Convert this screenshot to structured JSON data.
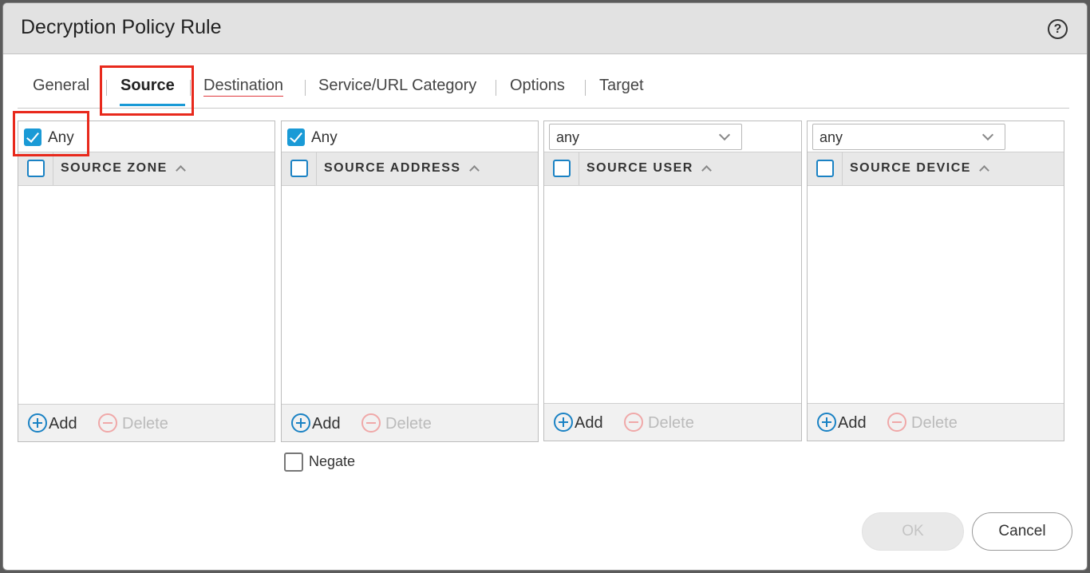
{
  "dialog": {
    "title": "Decryption Policy Rule",
    "help_icon": "question-circle-icon"
  },
  "tabs": [
    {
      "label": "General"
    },
    {
      "label": "Source",
      "active": true
    },
    {
      "label": "Destination"
    },
    {
      "label": "Service/URL Category"
    },
    {
      "label": "Options"
    },
    {
      "label": "Target"
    }
  ],
  "panels": {
    "source_zone": {
      "any_label": "Any",
      "any_checked": true,
      "header": "SOURCE ZONE"
    },
    "source_address": {
      "any_label": "Any",
      "any_checked": true,
      "header": "SOURCE ADDRESS"
    },
    "source_user": {
      "select_value": "any",
      "header": "SOURCE USER"
    },
    "source_device": {
      "select_value": "any",
      "header": "SOURCE DEVICE"
    }
  },
  "actions": {
    "add_label": "Add",
    "delete_label": "Delete"
  },
  "negate": {
    "label": "Negate",
    "checked": false
  },
  "buttons": {
    "ok_label": "OK",
    "cancel_label": "Cancel"
  },
  "colors": {
    "accent": "#1a9ad6",
    "highlight_box": "#e8291c",
    "titlebar": "#e2e2e2"
  }
}
